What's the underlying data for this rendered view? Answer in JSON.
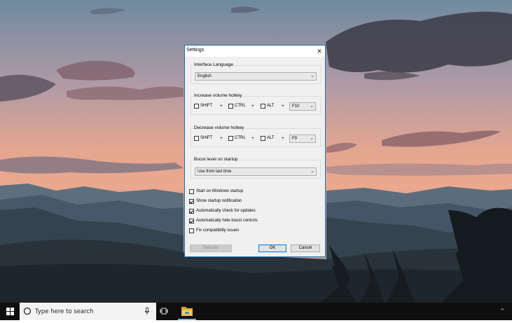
{
  "window": {
    "title": "Settings",
    "close_glyph": "✕"
  },
  "interface_language": {
    "label": "Interface Language",
    "selected": "English"
  },
  "increase_hotkey": {
    "label": "Increase volume hotkey",
    "shift": {
      "label": "SHIFT",
      "checked": false
    },
    "ctrl": {
      "label": "CTRL",
      "checked": false
    },
    "alt": {
      "label": "ALT",
      "checked": false
    },
    "plus": "+",
    "key": "F10"
  },
  "decrease_hotkey": {
    "label": "Decrease volume hotkey",
    "shift": {
      "label": "SHIFT",
      "checked": false
    },
    "ctrl": {
      "label": "CTRL",
      "checked": false
    },
    "alt": {
      "label": "ALT",
      "checked": false
    },
    "plus": "+",
    "key": "F9"
  },
  "boost_level": {
    "label": "Boost level on startup",
    "selected": "Use from last time"
  },
  "options": [
    {
      "label": "Start on Windows startup",
      "checked": false
    },
    {
      "label": "Show startup notification",
      "checked": true
    },
    {
      "label": "Automatically check for updates",
      "checked": true
    },
    {
      "label": "Automatically hide boost controls",
      "checked": true
    },
    {
      "label": "Fix compatibility issues",
      "checked": false
    }
  ],
  "buttons": {
    "defaults": "Defaults",
    "ok": "OK",
    "cancel": "Cancel"
  },
  "taskbar": {
    "search_placeholder": "Type here to search",
    "accent_color": "#76b9ed"
  },
  "icons": [
    "windows-start-icon",
    "cortana-circle-icon",
    "microphone-icon",
    "task-view-icon",
    "file-explorer-icon",
    "chevron-up-icon",
    "close-icon",
    "chevron-down-icon"
  ]
}
